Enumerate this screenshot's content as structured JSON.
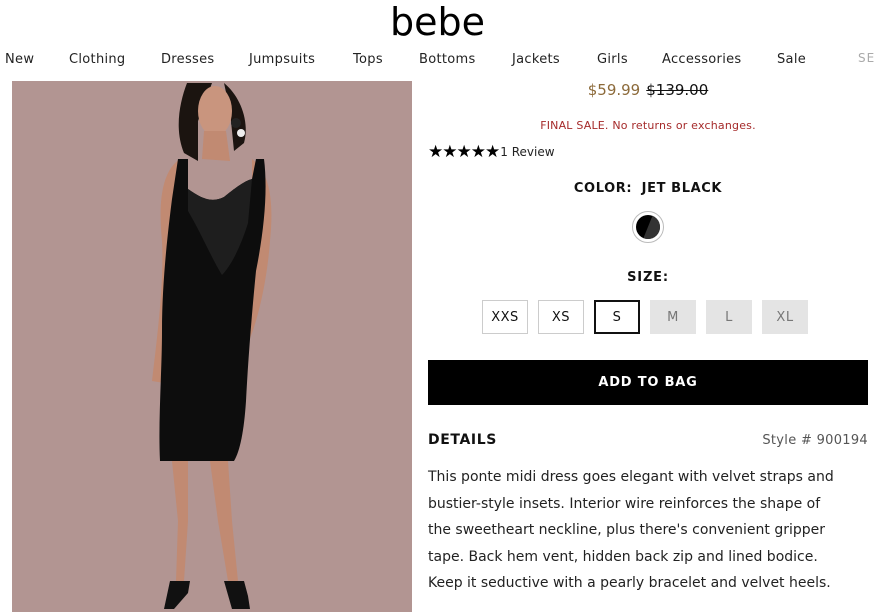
{
  "brand": {
    "logo": "bebe"
  },
  "nav": {
    "items": [
      "New",
      "Clothing",
      "Dresses",
      "Jumpsuits",
      "Tops",
      "Bottoms",
      "Jackets",
      "Girls",
      "Accessories",
      "Sale"
    ],
    "search_fragment": "SE"
  },
  "product": {
    "sale_price": "$59.99",
    "original_price": "$139.00",
    "final_sale_notice": "FINAL SALE. No returns or exchanges.",
    "rating": 5,
    "rating_max": 5,
    "review_text": "1 Review",
    "color_label": "COLOR:",
    "color_value": "JET BLACK",
    "size_label": "SIZE:",
    "sizes": [
      {
        "label": "XXS",
        "state": "available"
      },
      {
        "label": "XS",
        "state": "available"
      },
      {
        "label": "S",
        "state": "selected"
      },
      {
        "label": "M",
        "state": "unavailable"
      },
      {
        "label": "L",
        "state": "unavailable"
      },
      {
        "label": "XL",
        "state": "unavailable"
      }
    ],
    "add_to_bag": "ADD TO BAG",
    "details_heading": "DETAILS",
    "style_number": "Style # 900194",
    "description_lines": [
      "This ponte midi dress goes elegant with velvet straps and",
      "bustier-style insets. Interior wire reinforces the shape of",
      "the sweetheart neckline, plus there's convenient gripper",
      "tape. Back hem vent, hidden back zip and lined bodice.",
      "Keep it seductive with a pearly bracelet and velvet heels."
    ]
  },
  "colors": {
    "sale_price": "#8c6a3a",
    "final_sale": "#a52a2a",
    "photo_background": "#b29592",
    "button_background": "#000000"
  }
}
